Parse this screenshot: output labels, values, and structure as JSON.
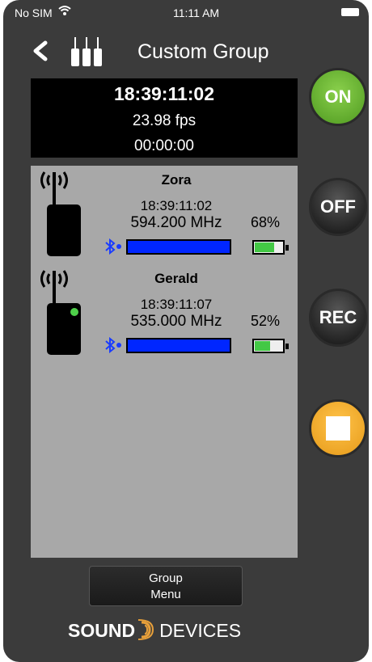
{
  "status_bar": {
    "carrier": "No SIM",
    "time": "11:11 AM"
  },
  "header": {
    "title": "Custom Group",
    "back_icon": "chevron-left-icon",
    "group_icon": "transmitters-icon"
  },
  "timecode": {
    "main": "18:39:11:02",
    "fps": "23.98 fps",
    "secondary": "00:00:00"
  },
  "devices": [
    {
      "name": "Zora",
      "timecode": "18:39:11:02",
      "frequency": "594.200 MHz",
      "battery_percent": "68%",
      "battery_fill": 0.68,
      "meter_fill": 1.0,
      "status_led": false
    },
    {
      "name": "Gerald",
      "timecode": "18:39:11:07",
      "frequency": "535.000 MHz",
      "battery_percent": "52%",
      "battery_fill": 0.52,
      "meter_fill": 1.0,
      "status_led": true
    }
  ],
  "controls": {
    "on_label": "ON",
    "off_label": "OFF",
    "rec_label": "REC",
    "stop_icon": "stop-icon"
  },
  "group_menu": {
    "line1": "Group",
    "line2": "Menu"
  },
  "logo": {
    "left": "SOUND",
    "right": "DEVICES"
  },
  "colors": {
    "on": "#4f9a20",
    "stop": "#e69a19",
    "meter": "#0026ff",
    "battery": "#43c845",
    "panel": "#a8a8a8"
  }
}
